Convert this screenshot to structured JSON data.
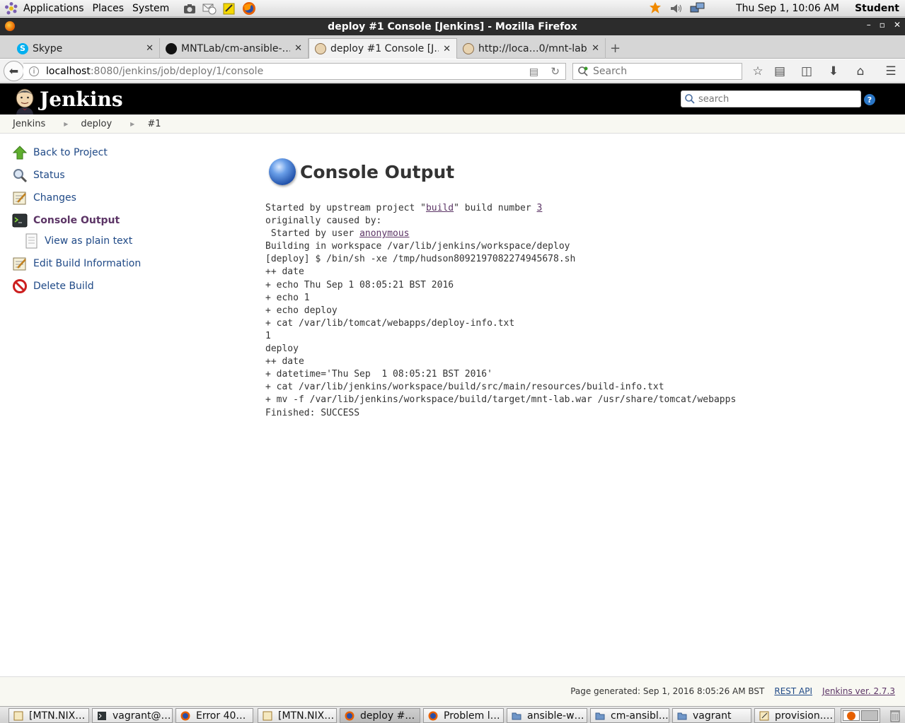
{
  "top_panel": {
    "menus": [
      "Applications",
      "Places",
      "System"
    ],
    "clock": "Thu Sep  1, 10:06 AM",
    "user": "Student"
  },
  "window": {
    "title": "deploy #1 Console [Jenkins] - Mozilla Firefox"
  },
  "tabs": [
    {
      "title": "Skype",
      "icon": "skype-icon"
    },
    {
      "title": "MNTLab/cm-ansible-…",
      "icon": "github-icon"
    },
    {
      "title": "deploy #1 Console [J…",
      "icon": "jenkins-icon",
      "active": true
    },
    {
      "title": "http://loca…0/mnt-lab/",
      "icon": "jenkins-icon"
    }
  ],
  "navbar": {
    "url_host": "localhost",
    "url_rest": ":8080/jenkins/job/deploy/1/console",
    "search_placeholder": "Search"
  },
  "jenkins": {
    "brand": "Jenkins",
    "search_placeholder": "search",
    "help": "?"
  },
  "breadcrumb": [
    "Jenkins",
    "deploy",
    "#1"
  ],
  "sidebar": {
    "items": [
      {
        "label": "Back to Project",
        "icon": "up-arrow-icon"
      },
      {
        "label": "Status",
        "icon": "magnifier-icon"
      },
      {
        "label": "Changes",
        "icon": "notepad-icon"
      },
      {
        "label": "Console Output",
        "icon": "terminal-icon",
        "current": true
      },
      {
        "label": "View as plain text",
        "icon": "document-icon",
        "sub": true
      },
      {
        "label": "Edit Build Information",
        "icon": "notepad-icon"
      },
      {
        "label": "Delete Build",
        "icon": "no-entry-icon"
      }
    ]
  },
  "main": {
    "title": "Console Output",
    "status_color": "#3465a4",
    "console": {
      "l1_pre": "Started by upstream project \"",
      "l1_link1": "build",
      "l1_mid": "\" build number ",
      "l1_link2": "3",
      "l2": "originally caused by:",
      "l3_pre": " Started by user ",
      "l3_link": "anonymous",
      "rest": "Building in workspace /var/lib/jenkins/workspace/deploy\n[deploy] $ /bin/sh -xe /tmp/hudson8092197082274945678.sh\n++ date\n+ echo Thu Sep 1 08:05:21 BST 2016\n+ echo 1\n+ echo deploy\n+ cat /var/lib/tomcat/webapps/deploy-info.txt\n1\ndeploy\n++ date\n+ datetime='Thu Sep  1 08:05:21 BST 2016'\n+ cat /var/lib/jenkins/workspace/build/src/main/resources/build-info.txt\n+ mv -f /var/lib/jenkins/workspace/build/target/mnt-lab.war /usr/share/tomcat/webapps\nFinished: SUCCESS"
    }
  },
  "footer": {
    "generated": "Page generated: Sep 1, 2016 8:05:26 AM BST",
    "rest_api": "REST API",
    "version": "Jenkins ver. 2.7.3"
  },
  "taskbar": [
    {
      "label": "[MTN.NIX…",
      "icon": "text-editor-icon"
    },
    {
      "label": "vagrant@…",
      "icon": "terminal-icon"
    },
    {
      "label": "Error 40…",
      "icon": "firefox-icon"
    },
    {
      "label": "[MTN.NIX…",
      "icon": "text-editor-icon"
    },
    {
      "label": "deploy #…",
      "icon": "firefox-icon",
      "active": true
    },
    {
      "label": "Problem l…",
      "icon": "firefox-icon"
    },
    {
      "label": "ansible-w…",
      "icon": "folder-icon"
    },
    {
      "label": "cm-ansibl…",
      "icon": "folder-icon"
    },
    {
      "label": "vagrant",
      "icon": "folder-icon"
    },
    {
      "label": "provision.…",
      "icon": "text-editor-icon"
    }
  ]
}
